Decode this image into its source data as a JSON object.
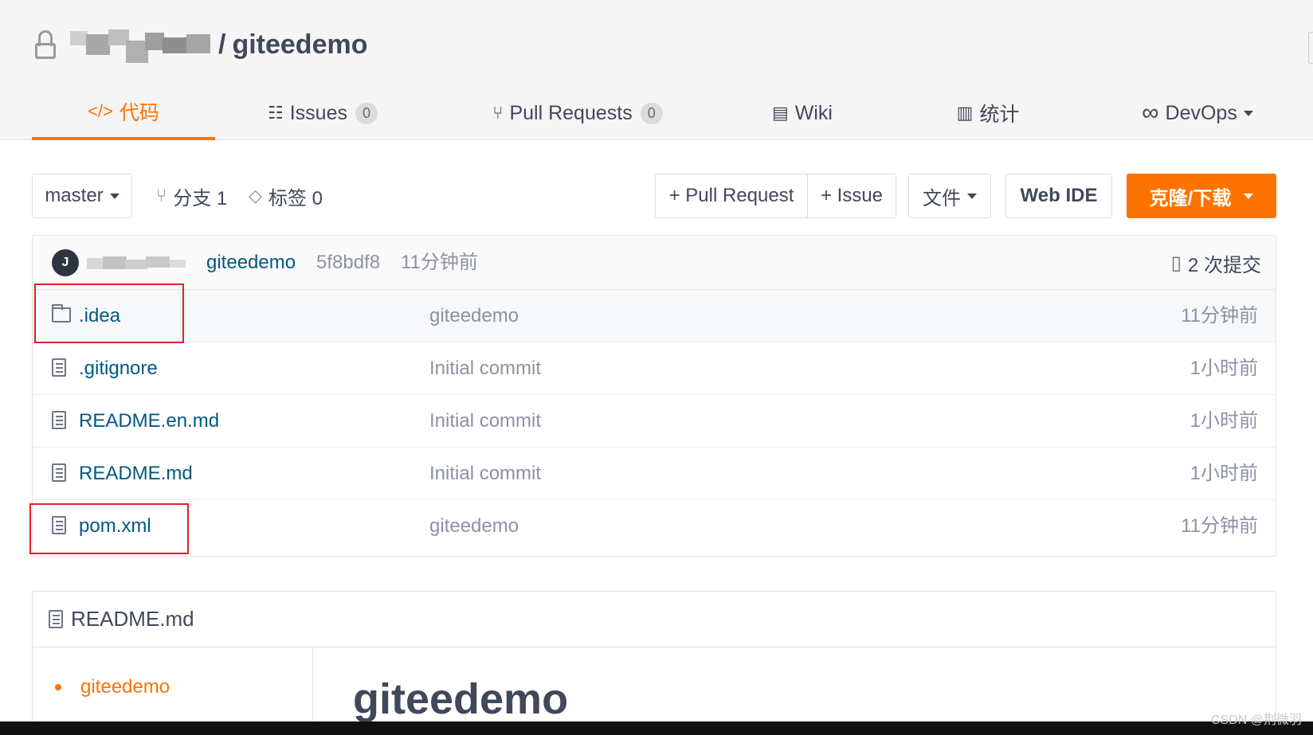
{
  "repo": {
    "separator": "/",
    "name": "giteedemo"
  },
  "tabs": [
    {
      "icon": "code-icon",
      "label": "代码",
      "active": true
    },
    {
      "icon": "issues-icon",
      "label": "Issues",
      "count": "0"
    },
    {
      "icon": "pull-request-icon",
      "label": "Pull Requests",
      "count": "0"
    },
    {
      "icon": "wiki-icon",
      "label": "Wiki"
    },
    {
      "icon": "chart-icon",
      "label": "统计"
    },
    {
      "icon": "infinity-icon",
      "label": "DevOps"
    }
  ],
  "toolbar": {
    "branch": "master",
    "branches": "分支 1",
    "tags": "标签 0",
    "pull_request": "+ Pull Request",
    "issue": "+ Issue",
    "file": "文件",
    "web_ide": "Web IDE",
    "clone": "克隆/下载"
  },
  "colors": {
    "accent": "#fe7300",
    "link": "#005980",
    "muted": "#8c92a4",
    "highlight_box": "#e0212b"
  },
  "latest_commit": {
    "avatar": "J",
    "message": "giteedemo",
    "hash": "5f8bdf8",
    "time": "11分钟前",
    "count": "2 次提交"
  },
  "files": [
    {
      "type": "folder",
      "name": ".idea",
      "commit": "giteedemo",
      "time": "11分钟前",
      "highlighted": true
    },
    {
      "type": "file",
      "name": ".gitignore",
      "commit": "Initial commit",
      "time": "1小时前"
    },
    {
      "type": "file",
      "name": "README.en.md",
      "commit": "Initial commit",
      "time": "1小时前"
    },
    {
      "type": "file",
      "name": "README.md",
      "commit": "Initial commit",
      "time": "1小时前"
    },
    {
      "type": "file",
      "name": "pom.xml",
      "commit": "giteedemo",
      "time": "11分钟前",
      "highlighted": true
    }
  ],
  "readme": {
    "title": "README.md",
    "toc_item": "giteedemo",
    "heading": "giteedemo"
  },
  "watermark": "CSDN @荆微羽"
}
